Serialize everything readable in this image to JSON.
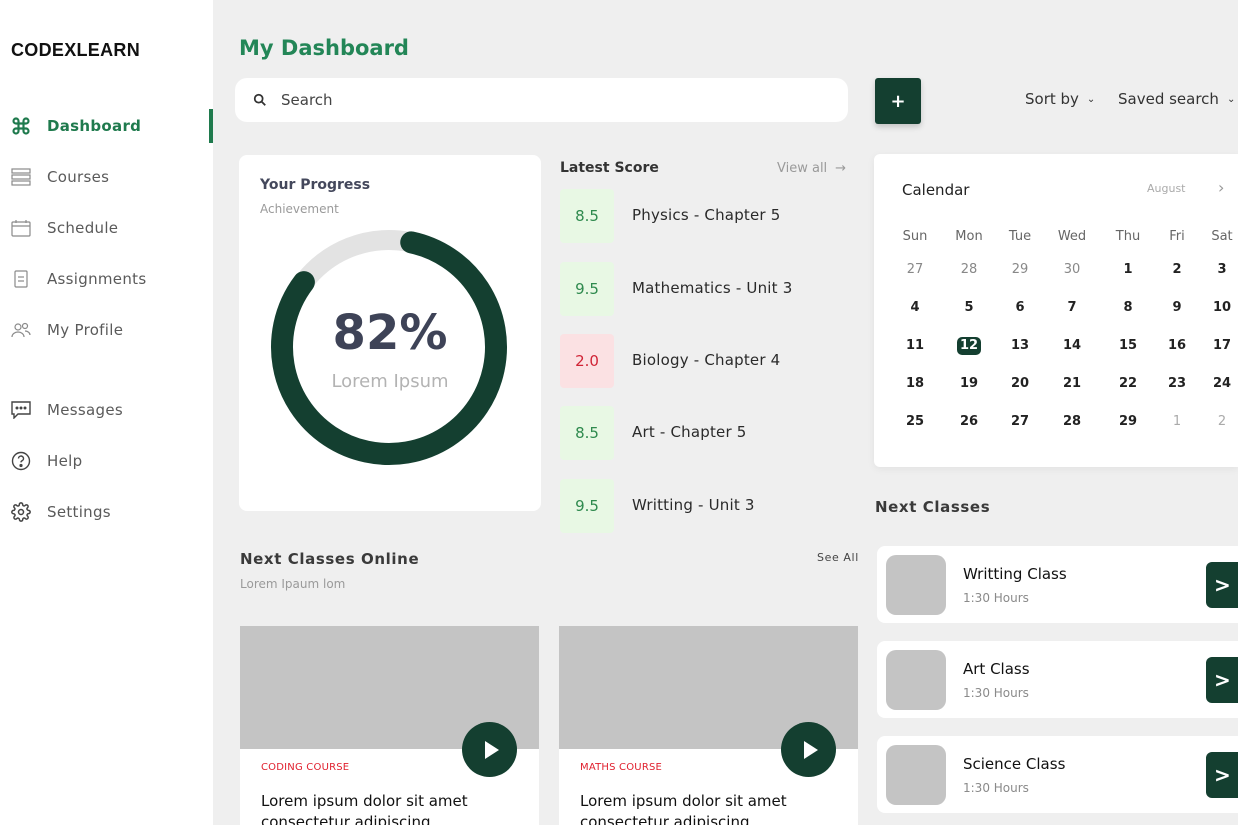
{
  "brand": "CODEXLEARN",
  "sidebar": {
    "items": [
      {
        "label": "Dashboard",
        "icon": "command-icon",
        "active": true
      },
      {
        "label": "Courses",
        "icon": "list-icon"
      },
      {
        "label": "Schedule",
        "icon": "calendar-icon"
      },
      {
        "label": "Assignments",
        "icon": "document-icon"
      },
      {
        "label": "My Profile",
        "icon": "users-icon"
      },
      {
        "label": "Messages",
        "icon": "chat-icon"
      },
      {
        "label": "Help",
        "icon": "help-icon"
      },
      {
        "label": "Settings",
        "icon": "gear-icon"
      }
    ]
  },
  "header": {
    "title": "My Dashboard",
    "search_placeholder": "Search",
    "add_label": "+",
    "sort_label": "Sort by",
    "saved_search_label": "Saved search"
  },
  "progress": {
    "title": "Your Progress",
    "subtitle": "Achievement",
    "value_text": "82%",
    "value": 0.82,
    "label": "Lorem Ipsum"
  },
  "latest_score": {
    "title": "Latest Score",
    "view_all": "View all",
    "items": [
      {
        "score": "8.5",
        "name": "Physics - Chapter 5",
        "status": "good"
      },
      {
        "score": "9.5",
        "name": "Mathematics - Unit 3",
        "status": "good"
      },
      {
        "score": "2.0",
        "name": "Biology - Chapter 4",
        "status": "bad"
      },
      {
        "score": "8.5",
        "name": "Art - Chapter 5",
        "status": "good"
      },
      {
        "score": "9.5",
        "name": "Writting - Unit 3",
        "status": "good"
      }
    ]
  },
  "calendar": {
    "title": "Calendar",
    "month": "August",
    "days_of_week": [
      "Sun",
      "Mon",
      "Tue",
      "Wed",
      "Thu",
      "Fri",
      "Sat"
    ],
    "weeks": [
      [
        "27",
        "28",
        "29",
        "30",
        "1",
        "2",
        "3"
      ],
      [
        "4",
        "5",
        "6",
        "7",
        "8",
        "9",
        "10"
      ],
      [
        "11",
        "12",
        "13",
        "14",
        "15",
        "16",
        "17"
      ],
      [
        "18",
        "19",
        "20",
        "21",
        "22",
        "23",
        "24"
      ],
      [
        "25",
        "26",
        "27",
        "28",
        "29",
        "1",
        "2"
      ]
    ],
    "today": "12"
  },
  "next_classes": {
    "title": "Next Classes",
    "items": [
      {
        "name": "Writting Class",
        "hours": "1:30 Hours",
        "go_label": ">"
      },
      {
        "name": "Art Class",
        "hours": "1:30 Hours",
        "go_label": ">"
      },
      {
        "name": "Science Class",
        "hours": "1:30 Hours",
        "go_label": ">"
      }
    ]
  },
  "online_classes": {
    "title": "Next Classes Online",
    "subtitle": "Lorem Ipaum lom",
    "see_all": "See All",
    "courses": [
      {
        "tag": "CODING COURSE",
        "headline": "Lorem ipsum dolor sit amet consectetur adipiscing"
      },
      {
        "tag": "MATHS COURSE",
        "headline": "Lorem ipsum dolor sit amet consectetur adipiscing"
      }
    ]
  },
  "colors": {
    "accent": "#238657",
    "dark_green": "#143f30",
    "good_bg": "#e8f8e4",
    "bad_bg": "#fbe1e3",
    "bad_text": "#d02436"
  }
}
